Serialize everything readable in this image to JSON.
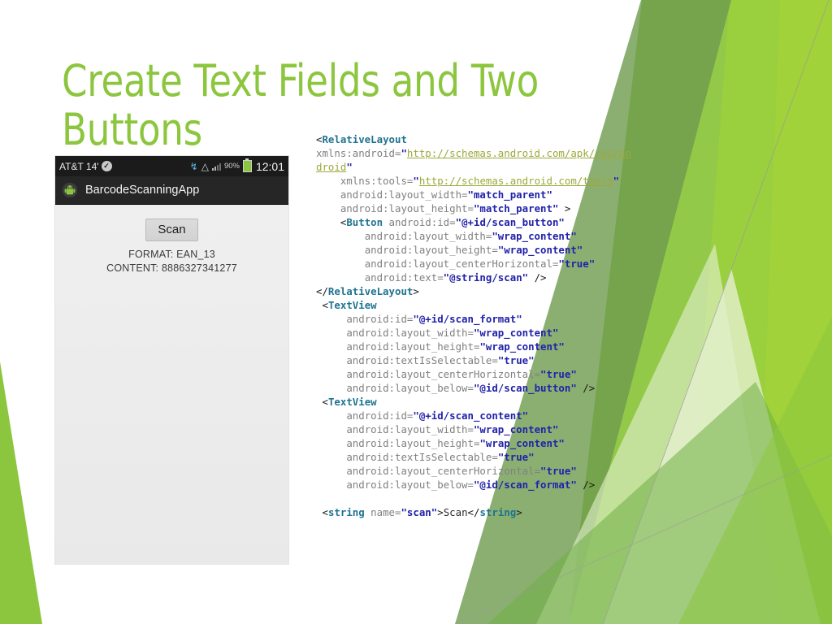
{
  "slide": {
    "title": "Create Text Fields and Two Buttons",
    "accent_green": "#8CC63E",
    "background": "#FFFFFF"
  },
  "phone": {
    "status_bar": {
      "carrier": "AT&T 14'",
      "check_icon": "check-icon",
      "bluetooth_icon": "bluetooth-icon",
      "wifi_icon": "wifi-icon",
      "signal_icon": "signal-bars-icon",
      "battery_percent": "90%",
      "battery_icon": "battery-icon",
      "time": "12:01"
    },
    "action_bar": {
      "app_icon": "android-robot-icon",
      "app_name": "BarcodeScanningApp"
    },
    "content": {
      "scan_button": "Scan",
      "format_line": "FORMAT: EAN_13",
      "content_line": "CONTENT: 8886327341277"
    }
  },
  "code": {
    "lines": [
      [
        {
          "t": "brk",
          "s": "<"
        },
        {
          "t": "tag",
          "s": "RelativeLayout"
        }
      ],
      [
        {
          "t": "attr",
          "s": "xmlns:android="
        },
        {
          "t": "val",
          "s": "\""
        },
        {
          "t": "url",
          "s": "http://schemas.android.com/apk/res/android"
        },
        {
          "t": "val",
          "s": "\""
        }
      ],
      [
        {
          "t": "attr",
          "s": "    xmlns:tools="
        },
        {
          "t": "val",
          "s": "\""
        },
        {
          "t": "url",
          "s": "http://schemas.android.com/tools"
        },
        {
          "t": "val",
          "s": "\""
        }
      ],
      [
        {
          "t": "attr",
          "s": "    android:layout_width="
        },
        {
          "t": "val",
          "s": "\"match_parent\""
        }
      ],
      [
        {
          "t": "attr",
          "s": "    android:layout_height="
        },
        {
          "t": "val",
          "s": "\"match_parent\""
        },
        {
          "t": "brk",
          "s": " >"
        }
      ],
      [
        {
          "t": "brk",
          "s": "    <"
        },
        {
          "t": "tag",
          "s": "Button"
        },
        {
          "t": "attr",
          "s": " android:id="
        },
        {
          "t": "val",
          "s": "\"@+id/scan_button\""
        }
      ],
      [
        {
          "t": "attr",
          "s": "        android:layout_width="
        },
        {
          "t": "val",
          "s": "\"wrap_content\""
        }
      ],
      [
        {
          "t": "attr",
          "s": "        android:layout_height="
        },
        {
          "t": "val",
          "s": "\"wrap_content\""
        }
      ],
      [
        {
          "t": "attr",
          "s": "        android:layout_centerHorizontal="
        },
        {
          "t": "val",
          "s": "\"true\""
        }
      ],
      [
        {
          "t": "attr",
          "s": "        android:text="
        },
        {
          "t": "val",
          "s": "\"@string/scan\""
        },
        {
          "t": "brk",
          "s": " />"
        }
      ],
      [
        {
          "t": "brk",
          "s": "</"
        },
        {
          "t": "tag",
          "s": "RelativeLayout"
        },
        {
          "t": "brk",
          "s": ">"
        }
      ],
      [
        {
          "t": "brk",
          "s": " <"
        },
        {
          "t": "tag",
          "s": "TextView"
        }
      ],
      [
        {
          "t": "attr",
          "s": "     android:id="
        },
        {
          "t": "val",
          "s": "\"@+id/scan_format\""
        }
      ],
      [
        {
          "t": "attr",
          "s": "     android:layout_width="
        },
        {
          "t": "val",
          "s": "\"wrap_content\""
        }
      ],
      [
        {
          "t": "attr",
          "s": "     android:layout_height="
        },
        {
          "t": "val",
          "s": "\"wrap_content\""
        }
      ],
      [
        {
          "t": "attr",
          "s": "     android:textIsSelectable="
        },
        {
          "t": "val",
          "s": "\"true\""
        }
      ],
      [
        {
          "t": "attr",
          "s": "     android:layout_centerHorizontal="
        },
        {
          "t": "val",
          "s": "\"true\""
        }
      ],
      [
        {
          "t": "attr",
          "s": "     android:layout_below="
        },
        {
          "t": "val",
          "s": "\"@id/scan_button\""
        },
        {
          "t": "brk",
          "s": " />"
        }
      ],
      [
        {
          "t": "brk",
          "s": " <"
        },
        {
          "t": "tag",
          "s": "TextView"
        }
      ],
      [
        {
          "t": "attr",
          "s": "     android:id="
        },
        {
          "t": "val",
          "s": "\"@+id/scan_content\""
        }
      ],
      [
        {
          "t": "attr",
          "s": "     android:layout_width="
        },
        {
          "t": "val",
          "s": "\"wrap_content\""
        }
      ],
      [
        {
          "t": "attr",
          "s": "     android:layout_height="
        },
        {
          "t": "val",
          "s": "\"wrap_content\""
        }
      ],
      [
        {
          "t": "attr",
          "s": "     android:textIsSelectable="
        },
        {
          "t": "val",
          "s": "\"true\""
        }
      ],
      [
        {
          "t": "attr",
          "s": "     android:layout_centerHorizontal="
        },
        {
          "t": "val",
          "s": "\"true\""
        }
      ],
      [
        {
          "t": "attr",
          "s": "     android:layout_below="
        },
        {
          "t": "val",
          "s": "\"@id/scan_format\""
        },
        {
          "t": "brk",
          "s": " />"
        }
      ],
      [
        {
          "t": "brk",
          "s": " "
        }
      ],
      [
        {
          "t": "brk",
          "s": " <"
        },
        {
          "t": "tag",
          "s": "string"
        },
        {
          "t": "attr",
          "s": " name="
        },
        {
          "t": "val",
          "s": "\"scan\""
        },
        {
          "t": "brk",
          "s": ">"
        },
        {
          "t": "txt",
          "s": "Scan"
        },
        {
          "t": "brk",
          "s": "</"
        },
        {
          "t": "tag",
          "s": "string"
        },
        {
          "t": "brk",
          "s": ">"
        }
      ]
    ]
  }
}
